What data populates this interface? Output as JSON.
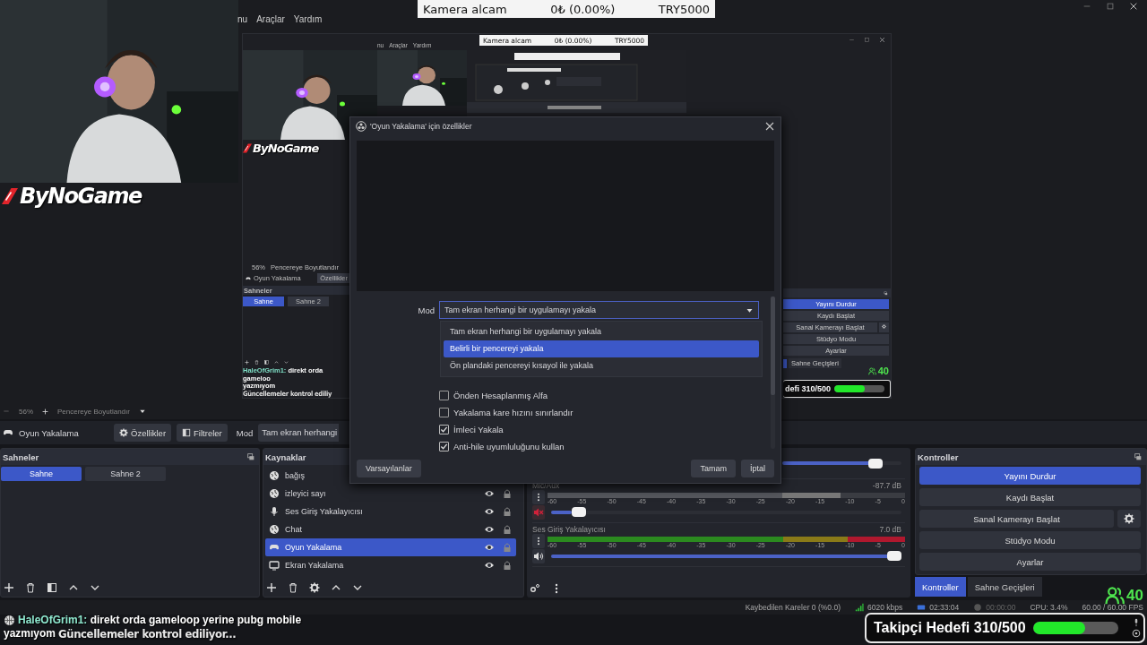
{
  "preview": {
    "menu": [
      "nu",
      "Araçlar",
      "Yardım"
    ],
    "banner": {
      "item": "Kamera alcam",
      "amount": "0₺ (0.00%)",
      "goal": "TRY5000"
    },
    "webcam": {
      "kind": "picture"
    },
    "logo": "ByNoGame",
    "nested": {
      "menu": [
        "nu",
        "Araçlar",
        "Yardım"
      ],
      "banner": {
        "item": "Kamera alcam",
        "amount": "0₺ (0.00%)",
        "goal": "TRY5000"
      },
      "logo": "ByNoGame",
      "zoom": "56%",
      "fit": "Pencereye Boyutlandır",
      "source": "Oyun Yakalama",
      "properties": "Özellikler",
      "scenes_title": "Sahneler",
      "scenes": [
        {
          "label": "Sahne",
          "selected": true
        },
        {
          "label": "Sahne 2",
          "selected": false
        }
      ],
      "chat": {
        "user": "HaleOfGrim1:",
        "message": "direkt orda gameloo",
        "cont": "yazmıyom",
        "update": "Güncellemeler kontrol ediliy"
      },
      "controls": [
        {
          "label": "Yayını Durdur",
          "active": true,
          "gear": false
        },
        {
          "label": "Kaydı Başlat",
          "active": false,
          "gear": false
        },
        {
          "label": "Sanal Kamerayı Başlat",
          "active": false,
          "gear": true
        },
        {
          "label": "Stüdyo Modu",
          "active": false,
          "gear": false
        },
        {
          "label": "Ayarlar",
          "active": false,
          "gear": false
        }
      ],
      "tab": "Sahne Geçişleri",
      "followers": "40",
      "goal": {
        "label": "defi 310/500",
        "level": 0.6
      }
    }
  },
  "dialog": {
    "title": "'Oyun Yakalama' için özellikler",
    "mode_label": "Mod",
    "mode_value": "Tam ekran herhangi bir uygulamayı yakala",
    "options": [
      {
        "label": "Tam ekran herhangi bir uygulamayı yakala",
        "selected": false
      },
      {
        "label": "Belirli bir pencereyi yakala",
        "selected": true
      },
      {
        "label": "Ön plandaki pencereyi kısayol ile yakala",
        "selected": false
      }
    ],
    "checkboxes": [
      {
        "label": "Önden Hesaplanmış Alfa",
        "checked": false
      },
      {
        "label": "Yakalama kare hızını sınırlandır",
        "checked": false
      },
      {
        "label": "İmleci Yakala",
        "checked": true
      },
      {
        "label": "Anti-hile uyumluluğunu kullan",
        "checked": true
      }
    ],
    "buttons": {
      "defaults": "Varsayılanlar",
      "ok": "Tamam",
      "cancel": "İptal"
    }
  },
  "zoom_bar": {
    "zoom": "56%",
    "fit": "Pencereye Boyutlandır"
  },
  "source_bar": {
    "source": "Oyun Yakalama",
    "properties": "Özellikler",
    "filters": "Filtreler",
    "mode_label": "Mod",
    "mode_value": "Tam ekran herhangi"
  },
  "scenes": {
    "title": "Sahneler",
    "items": [
      {
        "label": "Sahne",
        "selected": true
      },
      {
        "label": "Sahne 2",
        "selected": false
      }
    ]
  },
  "sources": {
    "title": "Kaynaklar",
    "items": [
      {
        "name": "bağış",
        "kind": "browser",
        "selected": false
      },
      {
        "name": "izleyici sayı",
        "kind": "browser",
        "selected": false
      },
      {
        "name": "Ses Giriş Yakalayıcısı",
        "kind": "mic",
        "selected": false
      },
      {
        "name": "Chat",
        "kind": "browser",
        "selected": false
      },
      {
        "name": "Oyun Yakalama",
        "kind": "game",
        "selected": true
      },
      {
        "name": "Ekran Yakalama",
        "kind": "display",
        "selected": false
      }
    ]
  },
  "mixer": {
    "channels": [
      {
        "kind": "partial",
        "volume": {
          "level": 0.82
        }
      },
      {
        "kind": "full",
        "name": "Mic/Aux",
        "db": "-87.7 dB",
        "muted": true,
        "meter": {
          "level": 0.82
        },
        "volume": {
          "level": 0.06
        },
        "scale": [
          "-60",
          "-55",
          "-50",
          "-45",
          "-40",
          "-35",
          "-30",
          "-25",
          "-20",
          "-15",
          "-10",
          "-5",
          "0"
        ]
      },
      {
        "kind": "full",
        "name": "Ses Giriş Yakalayıcısı",
        "db": "7.0 dB",
        "muted": false,
        "meter": {
          "level": 1
        },
        "volume": {
          "level": 1
        },
        "scale": [
          "-60",
          "-55",
          "-50",
          "-45",
          "-40",
          "-35",
          "-30",
          "-25",
          "-20",
          "-15",
          "-10",
          "-5",
          "0"
        ]
      }
    ]
  },
  "controls": {
    "title": "Kontroller",
    "buttons": [
      {
        "label": "Yayını Durdur",
        "active": true,
        "gear": false
      },
      {
        "label": "Kaydı Başlat",
        "active": false,
        "gear": false
      },
      {
        "label": "Sanal Kamerayı Başlat",
        "active": false,
        "gear": true
      },
      {
        "label": "Stüdyo Modu",
        "active": false,
        "gear": false
      },
      {
        "label": "Ayarlar",
        "active": false,
        "gear": false
      }
    ],
    "tabs": [
      {
        "label": "Kontroller",
        "selected": true
      },
      {
        "label": "Sahne Geçişleri",
        "selected": false
      }
    ]
  },
  "status_bar": {
    "dropped": "Kaybedilen Kareler 0 (%0.0)",
    "kbps": "6020 kbps",
    "stream_time": "02:33:04",
    "rec_time": "00:00:00",
    "cpu": "CPU: 3.4%",
    "fps": "60.00 / 60.00 FPS"
  },
  "overlay": {
    "chat": {
      "user": "HaleOfGrim1:",
      "message": "direkt orda gameloop yerine pubg mobile",
      "message_cont": "yazmıyom"
    },
    "update": "Güncellemeler kontrol ediliyor...",
    "followers": "40",
    "goal": {
      "label": "Takipçi Hedefi 310/500",
      "level": 0.62
    }
  }
}
